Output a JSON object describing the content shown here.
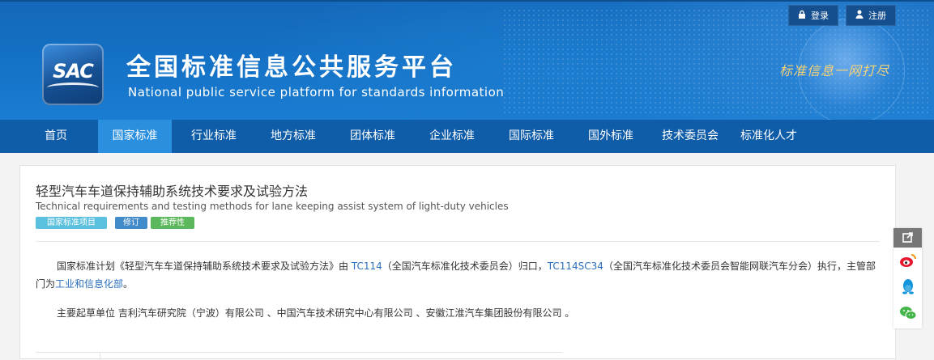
{
  "header": {
    "login_label": "登录",
    "register_label": "注册",
    "site_title": "全国标准信息公共服务平台",
    "site_subtitle": "National public service platform  for standards information",
    "logo_text": "SAC",
    "slogan": "标准信息一网打尽"
  },
  "nav": {
    "items": [
      {
        "label": "首页"
      },
      {
        "label": "国家标准",
        "active": true
      },
      {
        "label": "行业标准"
      },
      {
        "label": "地方标准"
      },
      {
        "label": "团体标准"
      },
      {
        "label": "企业标准"
      },
      {
        "label": "国际标准"
      },
      {
        "label": "国外标准"
      },
      {
        "label": "技术委员会"
      },
      {
        "label": "标准化人才"
      }
    ]
  },
  "standard": {
    "title_cn": "轻型汽车车道保持辅助系统技术要求及试验方法",
    "title_en": "Technical requirements and testing methods for lane keeping assist system of light-duty vehicles",
    "tags": [
      {
        "label": "国家标准项目",
        "color": "#5bc0de"
      },
      {
        "label": "修订",
        "color": "#428bca"
      },
      {
        "label": "推荐性",
        "color": "#5cb85c"
      }
    ],
    "para1": {
      "p1": "国家标准计划《轻型汽车车道保持辅助系统技术要求及试验方法》由 ",
      "tc": "TC114",
      "p2": "（全国汽车标准化技术委员会）归口，",
      "sc": "TC114SC34",
      "p3": "（全国汽车标准化技术委员会智能网联汽车分会）执行，主管部门为",
      "dept": "工业和信息化部",
      "p4": "。"
    },
    "para2": "主要起草单位 吉利汽车研究院（宁波）有限公司 、中国汽车技术研究中心有限公司 、安徽江淮汽车集团股份有限公司 。"
  },
  "colors": {
    "nav_bg": "#0f5ca9",
    "nav_active": "#2b8fe0",
    "link": "#2a6fbd"
  }
}
